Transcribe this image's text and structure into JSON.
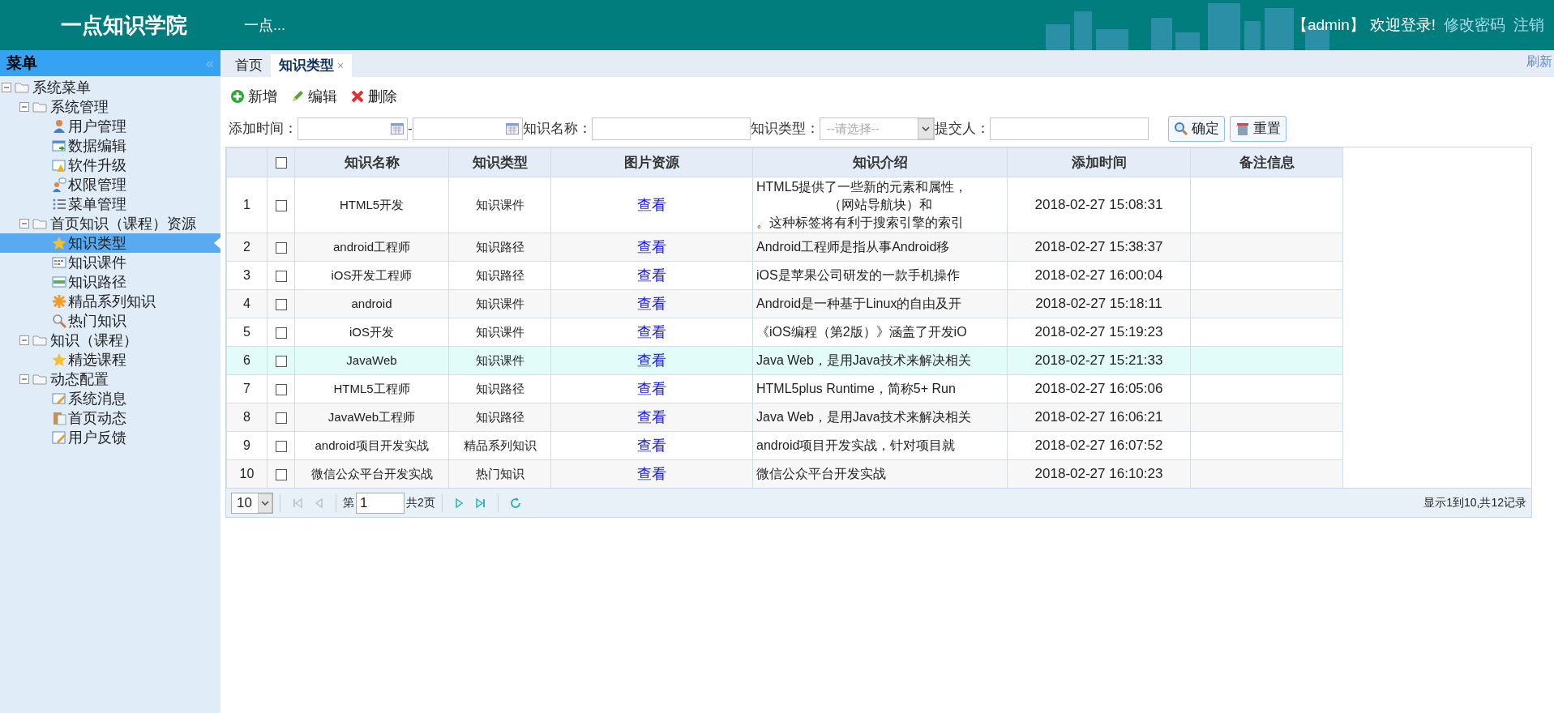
{
  "header": {
    "title": "一点知识学院",
    "subtitle": "一点...",
    "user": "【admin】",
    "welcome": "欢迎登录!",
    "links": [
      "修改密码",
      "注销"
    ]
  },
  "sidebar": {
    "title": "菜单",
    "collapse": "«",
    "tree": [
      {
        "label": "系统菜单",
        "expanded": true,
        "selected": false,
        "children": [
          {
            "label": "系统管理",
            "expanded": true,
            "selected": false,
            "children": [
              {
                "label": "用户管理",
                "selected": false
              },
              {
                "label": "数据编辑",
                "selected": false
              },
              {
                "label": "软件升级",
                "selected": false
              },
              {
                "label": "权限管理",
                "selected": false
              },
              {
                "label": "菜单管理",
                "selected": false
              }
            ]
          },
          {
            "label": "首页知识（课程）资源",
            "expanded": true,
            "selected": false,
            "children": [
              {
                "label": "知识类型",
                "selected": true
              },
              {
                "label": "知识课件",
                "selected": false
              },
              {
                "label": "知识路径",
                "selected": false
              },
              {
                "label": "精品系列知识",
                "selected": false
              },
              {
                "label": "热门知识",
                "selected": false
              }
            ]
          },
          {
            "label": "知识（课程）",
            "expanded": true,
            "selected": false,
            "children": [
              {
                "label": "精选课程",
                "selected": false
              }
            ]
          },
          {
            "label": "动态配置",
            "expanded": true,
            "selected": false,
            "children": [
              {
                "label": "系统消息",
                "selected": false
              },
              {
                "label": "首页动态",
                "selected": false
              },
              {
                "label": "用户反馈",
                "selected": false
              }
            ]
          }
        ]
      }
    ]
  },
  "tabs": [
    {
      "label": "首页",
      "selected": false
    },
    {
      "label": "知识类型",
      "selected": true,
      "close": "×"
    }
  ],
  "refresh": "刷新",
  "toolbar": [
    "新增",
    "编辑",
    "删除"
  ],
  "filters": [
    {
      "kind": "date",
      "label": "添加时间："
    },
    {
      "kind": "date",
      "label": "-"
    },
    {
      "kind": "text",
      "label": "知识名称："
    },
    {
      "kind": "select",
      "label": "知识类型：",
      "placeholder": "--请选择--"
    },
    {
      "kind": "text",
      "label": "提交人："
    }
  ],
  "filter_buttons": [
    "确定",
    "重置"
  ],
  "table": {
    "header_checked": false,
    "columns": [
      "知识名称",
      "知识类型",
      "图片资源",
      "知识介绍",
      "添加时间",
      "备注信息"
    ],
    "rows": [
      {
        "no": "1",
        "checked": false,
        "name": "HTML5开发",
        "type": "知识课件",
        "image": "查看",
        "intro": [
          "HTML5提供了一些新的元素和属性，",
          "（网站导航块）和",
          "。这种标签将有利于搜索引擎的索引"
        ],
        "time": "2018-02-27 15:08:31",
        "highlighted": false
      },
      {
        "no": "2",
        "checked": false,
        "name": "android工程师",
        "type": "知识路径",
        "image": "查看",
        "intro": [
          "Android工程师是指从事Android移"
        ],
        "time": "2018-02-27 15:38:37",
        "highlighted": false
      },
      {
        "no": "3",
        "checked": false,
        "name": "iOS开发工程师",
        "type": "知识路径",
        "image": "查看",
        "intro": [
          "iOS是苹果公司研发的一款手机操作"
        ],
        "time": "2018-02-27 16:00:04",
        "highlighted": false
      },
      {
        "no": "4",
        "checked": false,
        "name": "android",
        "type": "知识课件",
        "image": "查看",
        "intro": [
          "Android是一种基于Linux的自由及开"
        ],
        "time": "2018-02-27 15:18:11",
        "highlighted": false
      },
      {
        "no": "5",
        "checked": false,
        "name": "iOS开发",
        "type": "知识课件",
        "image": "查看",
        "intro": [
          "《iOS编程（第2版）》涵盖了开发iO"
        ],
        "time": "2018-02-27 15:19:23",
        "highlighted": false
      },
      {
        "no": "6",
        "checked": false,
        "name": "JavaWeb",
        "type": "知识课件",
        "image": "查看",
        "intro": [
          "Java Web，是用Java技术来解决相关"
        ],
        "time": "2018-02-27 15:21:33",
        "highlighted": true
      },
      {
        "no": "7",
        "checked": false,
        "name": "HTML5工程师",
        "type": "知识路径",
        "image": "查看",
        "intro": [
          "HTML5plus Runtime，简称5+ Run"
        ],
        "time": "2018-02-27 16:05:06",
        "highlighted": false
      },
      {
        "no": "8",
        "checked": false,
        "name": "JavaWeb工程师",
        "type": "知识路径",
        "image": "查看",
        "intro": [
          "Java Web，是用Java技术来解决相关"
        ],
        "time": "2018-02-27 16:06:21",
        "highlighted": false
      },
      {
        "no": "9",
        "checked": false,
        "name": "android项目开发实战",
        "type": "精品系列知识",
        "image": "查看",
        "intro": [
          "android项目开发实战，针对项目就"
        ],
        "time": "2018-02-27 16:07:52",
        "highlighted": false
      },
      {
        "no": "10",
        "checked": false,
        "name": "微信公众平台开发实战",
        "type": "热门知识",
        "image": "查看",
        "intro": [
          "微信公众平台开发实战"
        ],
        "time": "2018-02-27 16:10:23",
        "highlighted": false
      }
    ]
  },
  "pagination": {
    "page_size": "10",
    "page_prefix": "第",
    "page": "1",
    "page_total": "共2页",
    "summary": "显示1到10,共12记录"
  }
}
